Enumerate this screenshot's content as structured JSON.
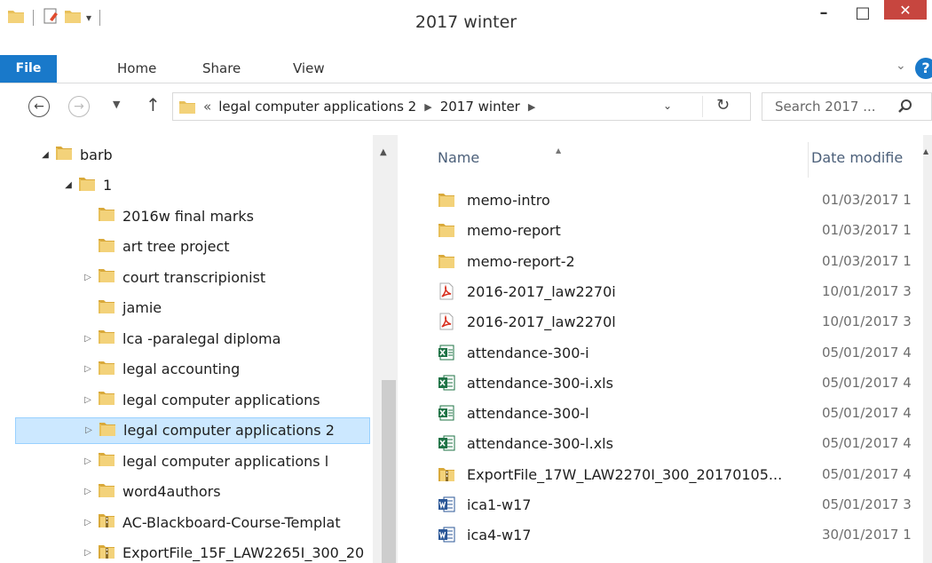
{
  "window": {
    "title": "2017 winter",
    "minimize_glyph": "–",
    "maximize_glyph": "□",
    "close_glyph": "✕"
  },
  "ribbon": {
    "tabs": [
      "File",
      "Home",
      "Share",
      "View"
    ],
    "help_glyph": "?"
  },
  "address": {
    "overflow": "«",
    "crumbs": [
      "legal computer applications 2",
      "2017 winter"
    ],
    "search_placeholder": "Search 2017 ..."
  },
  "tree": {
    "items": [
      {
        "label": "barb",
        "level": 0,
        "expander": "expanded",
        "icon": "folder-icon"
      },
      {
        "label": "1",
        "level": 1,
        "expander": "expanded",
        "icon": "folder-icon"
      },
      {
        "label": "2016w final marks",
        "level": 2,
        "expander": "none",
        "icon": "folder-icon"
      },
      {
        "label": "art tree project",
        "level": 2,
        "expander": "none",
        "icon": "folder-icon"
      },
      {
        "label": "court transcripionist",
        "level": 2,
        "expander": "collapsed",
        "icon": "folder-icon"
      },
      {
        "label": "jamie",
        "level": 2,
        "expander": "none",
        "icon": "folder-icon"
      },
      {
        "label": "lca -paralegal diploma",
        "level": 2,
        "expander": "collapsed",
        "icon": "folder-icon"
      },
      {
        "label": "legal accounting",
        "level": 2,
        "expander": "collapsed",
        "icon": "folder-icon"
      },
      {
        "label": "legal computer applications",
        "level": 2,
        "expander": "collapsed",
        "icon": "folder-icon"
      },
      {
        "label": "legal computer applications 2",
        "level": 2,
        "expander": "collapsed",
        "icon": "folder-icon",
        "selected": true
      },
      {
        "label": "legal computer applications l",
        "level": 2,
        "expander": "collapsed",
        "icon": "folder-icon"
      },
      {
        "label": "word4authors",
        "level": 2,
        "expander": "collapsed",
        "icon": "folder-icon"
      },
      {
        "label": "AC-Blackboard-Course-Templat",
        "level": 2,
        "expander": "collapsed",
        "icon": "zip-folder-icon"
      },
      {
        "label": "ExportFile_15F_LAW2265I_300_20",
        "level": 2,
        "expander": "collapsed",
        "icon": "zip-folder-icon"
      }
    ]
  },
  "content": {
    "columns": {
      "name": "Name",
      "date": "Date modifie"
    },
    "files": [
      {
        "name": "memo-intro",
        "date": "01/03/2017 1",
        "icon": "folder-icon"
      },
      {
        "name": "memo-report",
        "date": "01/03/2017 1",
        "icon": "folder-icon"
      },
      {
        "name": "memo-report-2",
        "date": "01/03/2017 1",
        "icon": "folder-icon"
      },
      {
        "name": "2016-2017_law2270i",
        "date": "10/01/2017 3",
        "icon": "pdf-icon"
      },
      {
        "name": "2016-2017_law2270l",
        "date": "10/01/2017 3",
        "icon": "pdf-icon"
      },
      {
        "name": "attendance-300-i",
        "date": "05/01/2017 4",
        "icon": "excel-csv-icon"
      },
      {
        "name": "attendance-300-i.xls",
        "date": "05/01/2017 4",
        "icon": "excel-icon"
      },
      {
        "name": "attendance-300-l",
        "date": "05/01/2017 4",
        "icon": "excel-csv-icon"
      },
      {
        "name": "attendance-300-l.xls",
        "date": "05/01/2017 4",
        "icon": "excel-icon"
      },
      {
        "name": "ExportFile_17W_LAW2270I_300_20170105...",
        "date": "05/01/2017 4",
        "icon": "zip-folder-icon"
      },
      {
        "name": "ica1-w17",
        "date": "05/01/2017 3",
        "icon": "word-icon"
      },
      {
        "name": "ica4-w17",
        "date": "30/01/2017 1",
        "icon": "word-icon"
      }
    ]
  },
  "colors": {
    "accent": "#1979ca",
    "close": "#c7463f",
    "selection": "#cce8ff",
    "folder": "#e8c05a"
  }
}
